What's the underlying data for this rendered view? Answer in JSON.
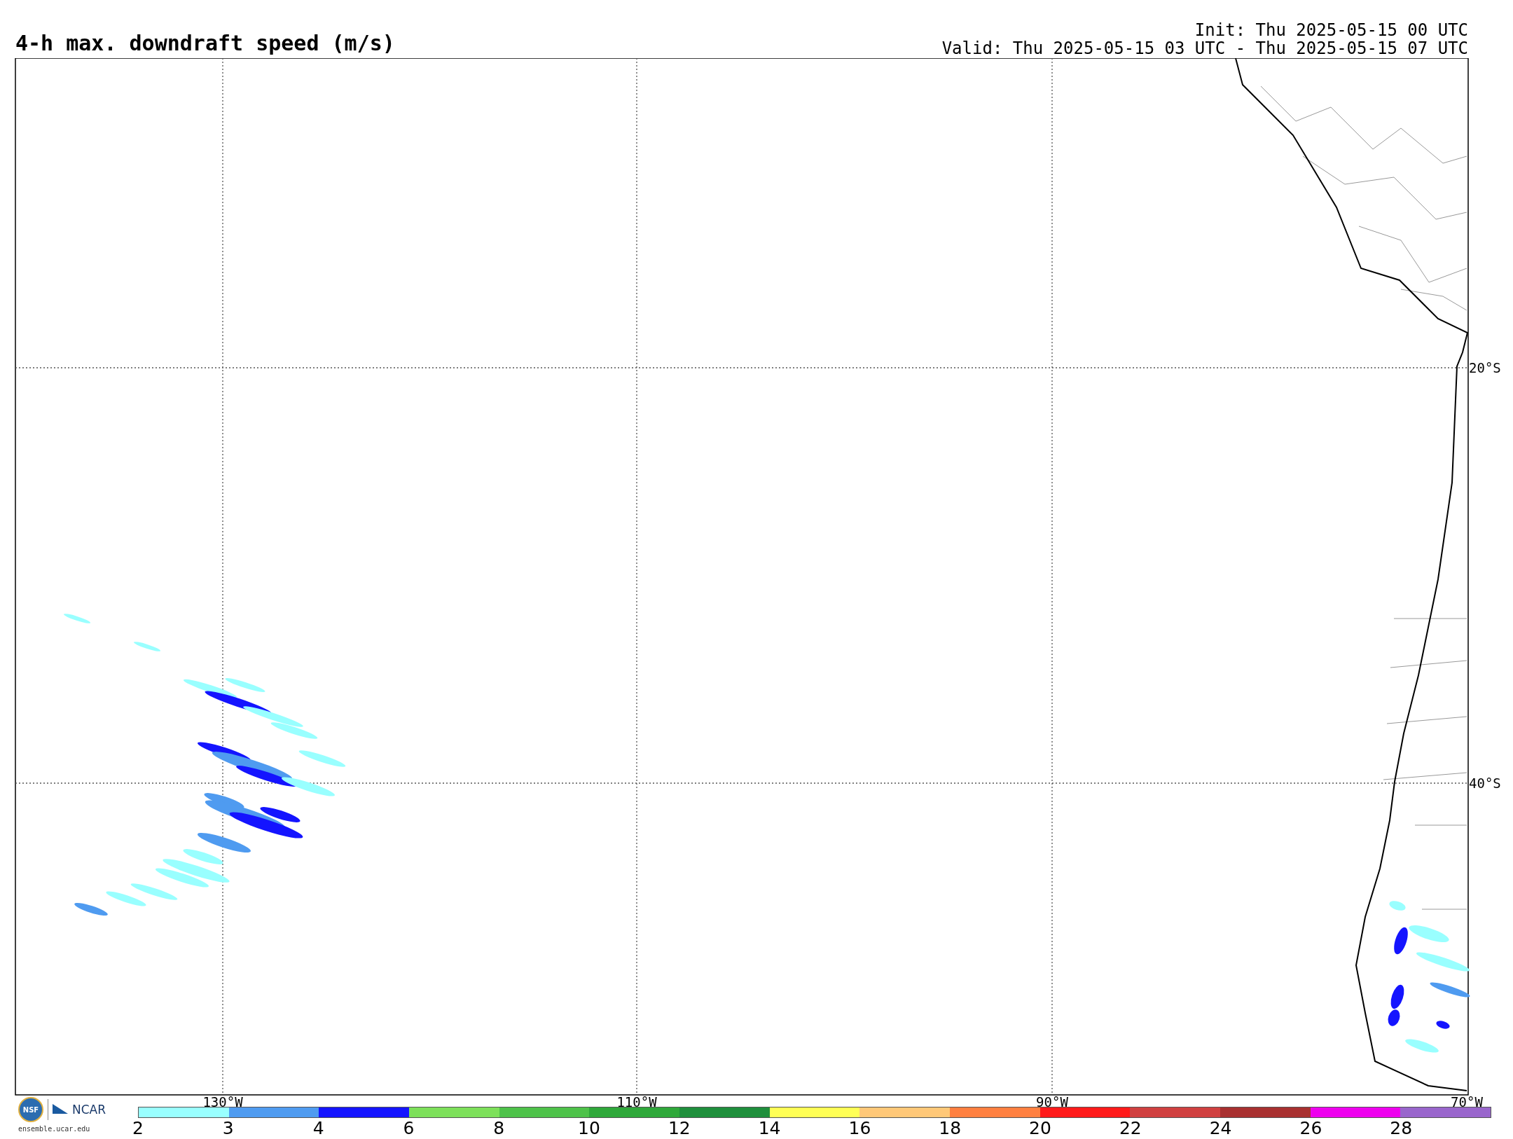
{
  "title": "4-h max. downdraft speed (m/s)",
  "init": "Init: Thu 2025-05-15 00 UTC",
  "valid": "Valid: Thu 2025-05-15 03 UTC - Thu 2025-05-15 07 UTC",
  "latitude_labels": [
    "20°S",
    "40°S"
  ],
  "longitude_labels": [
    "130°W",
    "110°W",
    "90°W",
    "70°W"
  ],
  "logo": {
    "seal": "NSF",
    "name": "NCAR",
    "url": "ensemble.ucar.edu"
  },
  "legend": [
    {
      "label": "2",
      "color": "#99ffff"
    },
    {
      "label": "3",
      "color": "#4f9bf0"
    },
    {
      "label": "4",
      "color": "#1414ff"
    },
    {
      "label": "6",
      "color": "#7de05a"
    },
    {
      "label": "8",
      "color": "#4ec24a"
    },
    {
      "label": "10",
      "color": "#2fa83a"
    },
    {
      "label": "12",
      "color": "#1f8f3c"
    },
    {
      "label": "14",
      "color": "#ffff55"
    },
    {
      "label": "16",
      "color": "#ffc878"
    },
    {
      "label": "18",
      "color": "#ff8040"
    },
    {
      "label": "20",
      "color": "#ff1a1a"
    },
    {
      "label": "22",
      "color": "#d04040"
    },
    {
      "label": "24",
      "color": "#a83030"
    },
    {
      "label": "26",
      "color": "#ee00ee"
    },
    {
      "label": "28",
      "color": "#9966cc"
    }
  ]
}
